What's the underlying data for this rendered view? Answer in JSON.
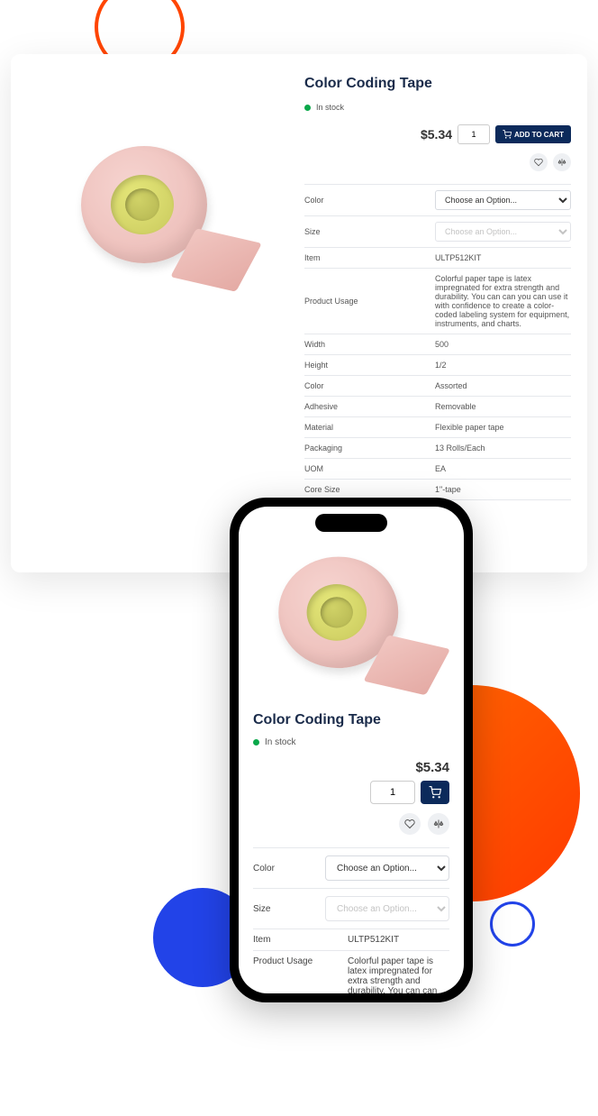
{
  "product": {
    "title": "Color Coding Tape",
    "stock_label": "In stock",
    "price": "$5.34",
    "qty": "1",
    "add_to_cart": "ADD TO CART"
  },
  "options": {
    "color_label": "Color",
    "color_placeholder": "Choose an Option...",
    "size_label": "Size",
    "size_placeholder": "Choose an Option..."
  },
  "specs": [
    {
      "label": "Item",
      "value": "ULTP512KIT"
    },
    {
      "label": "Product Usage",
      "value": "Colorful paper tape is latex impregnated for extra strength and durability. You can can you can use it with confidence to create a color-coded labeling system for equipment, instruments, and charts."
    },
    {
      "label": "Width",
      "value": "500"
    },
    {
      "label": "Height",
      "value": "1/2"
    },
    {
      "label": "Color",
      "value": "Assorted"
    },
    {
      "label": "Adhesive",
      "value": "Removable"
    },
    {
      "label": "Material",
      "value": "Flexible paper tape"
    },
    {
      "label": "Packaging",
      "value": "13 Rolls/Each"
    },
    {
      "label": "UOM",
      "value": "EA"
    },
    {
      "label": "Core Size",
      "value": "1\"-tape"
    }
  ],
  "mobile_specs": [
    {
      "label": "Item",
      "value": "ULTP512KIT"
    },
    {
      "label": "Product Usage",
      "value": "Colorful paper tape is latex impregnated for extra strength and durability. You can can you can use it with confidence to create a color-coded labeling system for equipment, instruments, and charts."
    },
    {
      "label": "Width",
      "value": "500"
    },
    {
      "label": "Height",
      "value": "1/2"
    }
  ],
  "colors": {
    "brand_dark": "#0c2a5b",
    "accent_green": "#0aa84a"
  }
}
